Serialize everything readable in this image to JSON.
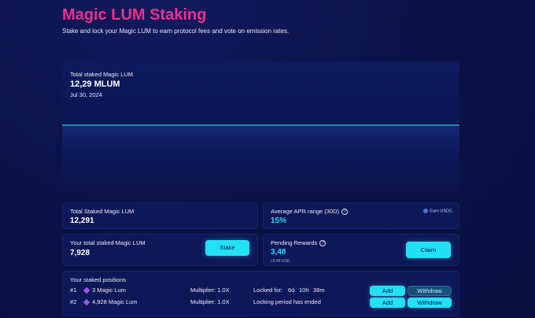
{
  "header": {
    "title": "Magic LUM Staking",
    "subtitle": "Stake and lock your Magic LUM to earn protocol fees and vote on emission rates."
  },
  "chart": {
    "label": "Total staked Magic LUM",
    "value": "12,29 MLUM",
    "date": "Jul 30, 2024"
  },
  "chart_data": {
    "type": "line",
    "series": [
      {
        "values": [
          12.29,
          12.29,
          12.29,
          12.29,
          12.29
        ]
      }
    ],
    "line_color": "#36c6ee"
  },
  "cards": {
    "total_staked": {
      "label": "Total Staked Magic LUM",
      "value": "12,291"
    },
    "apr": {
      "label": "Average APR range (30D)",
      "value": "15%",
      "earn_label": "Earn USDC"
    },
    "your_staked": {
      "label": "Your total staked Magic LUM",
      "value": "7,928",
      "button": "Stake"
    },
    "pending": {
      "label": "Pending Rewards",
      "value": "3,48",
      "usd": "≈3,48 USD",
      "button": "Claim"
    }
  },
  "positions": {
    "title": "Your staked positions",
    "rows": [
      {
        "index": "#1",
        "amount": "3 Magic Lum",
        "multiplier": "Multiplier: 1.0X",
        "lock_label": "Locked for:",
        "days": "6d",
        "hours": "10h",
        "minutes": "38m",
        "add": "Add",
        "withdraw": "Withdraw"
      },
      {
        "index": "#2",
        "amount": "4,928 Magic Lum",
        "multiplier": "Multiplier: 1.0X",
        "lock_text": "Locking period has ended",
        "add": "Add",
        "withdraw": "Withdraw"
      }
    ]
  },
  "colors": {
    "accent": "#22e1f5",
    "title": "#f0308c",
    "background": "#0a1145"
  },
  "icons": {
    "info": "info-icon",
    "usdc": "usdc-icon",
    "lum": "magic-lum-icon"
  }
}
